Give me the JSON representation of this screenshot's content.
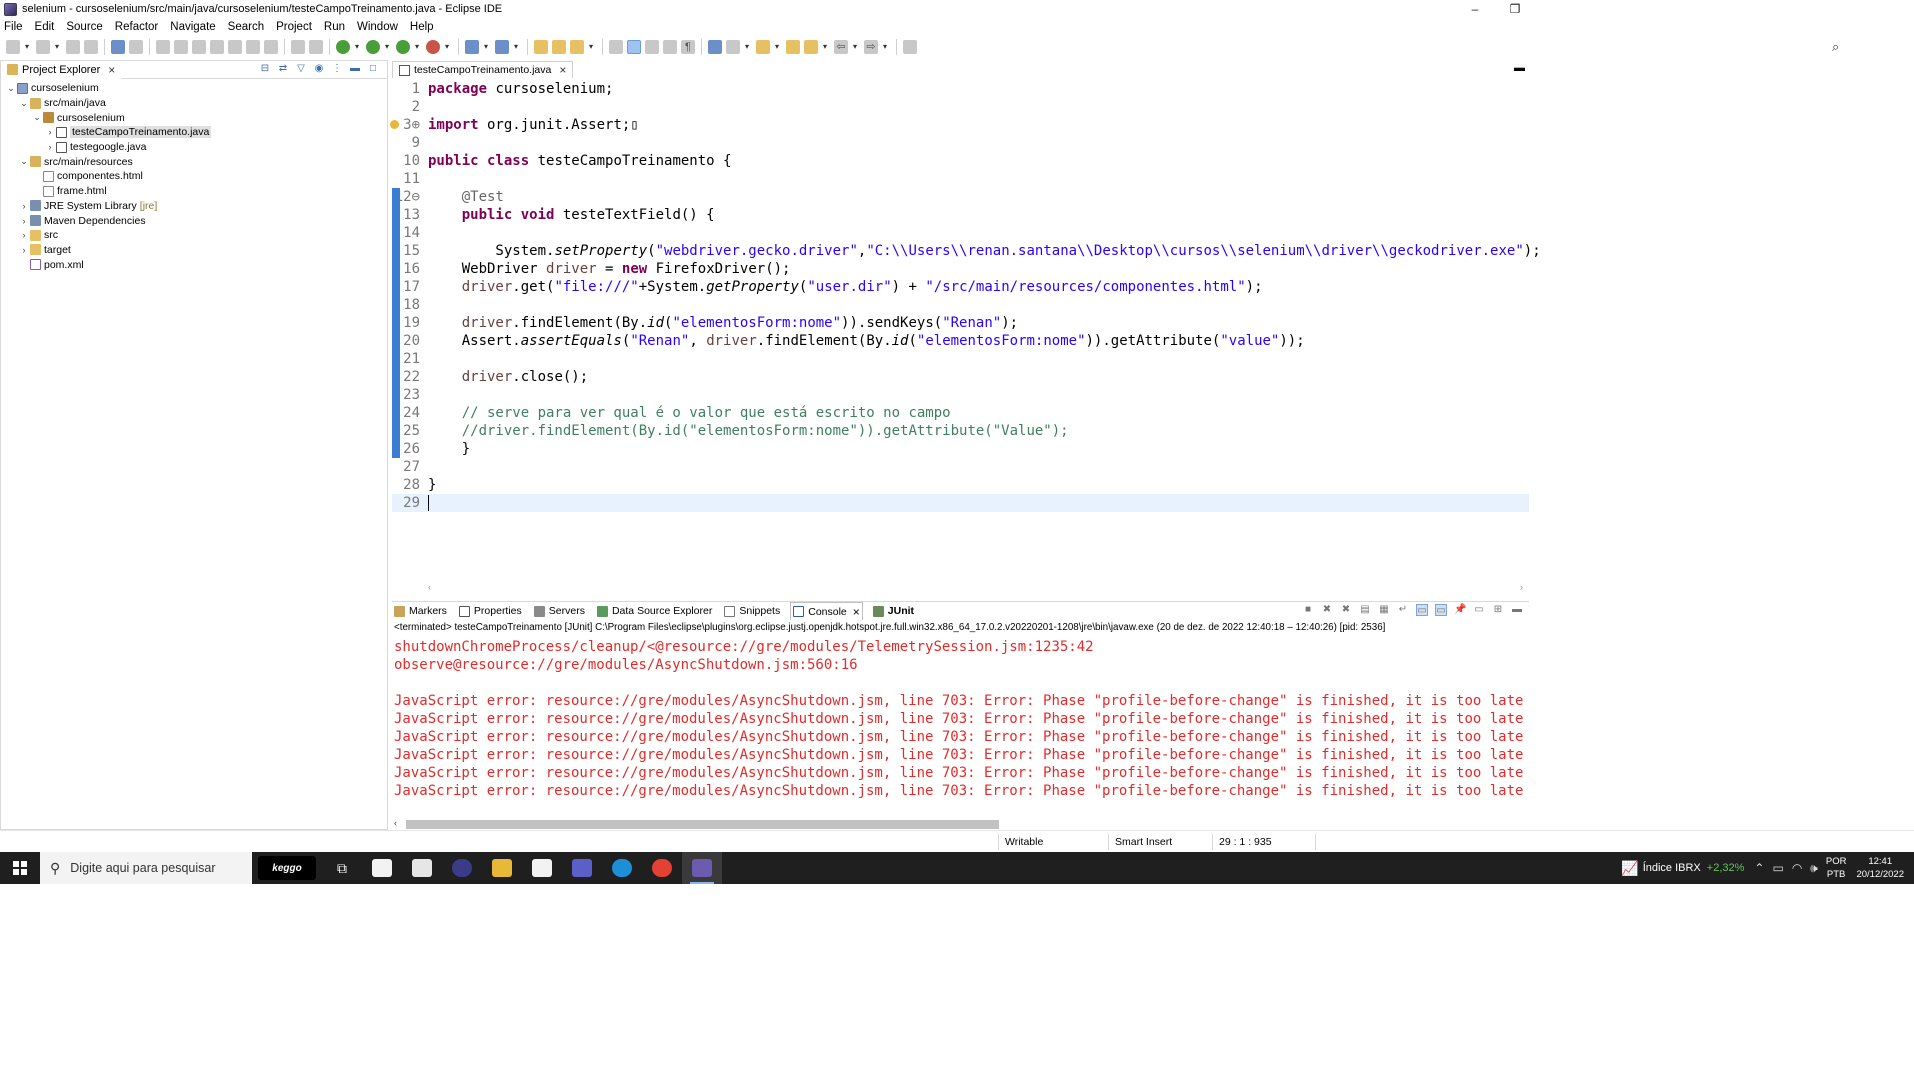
{
  "window": {
    "title": "selenium - cursoselenium/src/main/java/cursoselenium/testeCampoTreinamento.java - Eclipse IDE",
    "minimize": "–",
    "restore": "❐"
  },
  "menu": [
    "File",
    "Edit",
    "Source",
    "Refactor",
    "Navigate",
    "Search",
    "Project",
    "Run",
    "Window",
    "Help"
  ],
  "project_explorer": {
    "tab_label": "Project Explorer",
    "tree": [
      {
        "label": "cursoselenium",
        "twisty": "⌄",
        "icon": "proj",
        "indent": 0
      },
      {
        "label": "src/main/java",
        "twisty": "⌄",
        "icon": "srcf",
        "indent": 1
      },
      {
        "label": "cursoselenium",
        "twisty": "⌄",
        "icon": "pkg",
        "indent": 2
      },
      {
        "label": "testeCampoTreinamento.java",
        "twisty": "›",
        "icon": "java",
        "indent": 3,
        "selected": true
      },
      {
        "label": "testegoogle.java",
        "twisty": "›",
        "icon": "java",
        "indent": 3
      },
      {
        "label": "src/main/resources",
        "twisty": "⌄",
        "icon": "srcf",
        "indent": 1
      },
      {
        "label": "componentes.html",
        "twisty": "",
        "icon": "html",
        "indent": 2
      },
      {
        "label": "frame.html",
        "twisty": "",
        "icon": "html",
        "indent": 2
      },
      {
        "label": "JRE System Library",
        "decoration": "[jre]",
        "twisty": "›",
        "icon": "lib",
        "indent": 1
      },
      {
        "label": "Maven Dependencies",
        "twisty": "›",
        "icon": "lib",
        "indent": 1
      },
      {
        "label": "src",
        "twisty": "›",
        "icon": "fold",
        "indent": 1
      },
      {
        "label": "target",
        "twisty": "›",
        "icon": "fold",
        "indent": 1
      },
      {
        "label": "pom.xml",
        "twisty": "",
        "icon": "xml",
        "indent": 1
      }
    ]
  },
  "editor": {
    "tab_label": "testeCampoTreinamento.java",
    "lines": [
      {
        "n": "1",
        "html": "<span class=\"kw\">package</span> cursoselenium;"
      },
      {
        "n": "2",
        "html": ""
      },
      {
        "n": "3⊕",
        "html": "<span class=\"kw\">import</span> org.junit.Assert;▯"
      },
      {
        "n": "9",
        "html": ""
      },
      {
        "n": "10",
        "html": "<span class=\"kw\">public class</span> testeCampoTreinamento {"
      },
      {
        "n": "11",
        "html": ""
      },
      {
        "n": "12⊖",
        "html": "    <span class=\"ann\">@Test</span>"
      },
      {
        "n": "13",
        "html": "    <span class=\"kw\">public void</span> testeTextField() {"
      },
      {
        "n": "14",
        "html": ""
      },
      {
        "n": "15",
        "html": "        System.<span class=\"it\">setProperty</span>(<span class=\"str\">\"webdriver.gecko.driver\"</span>,<span class=\"str\">\"C:\\\\Users\\\\renan.santana\\\\Desktop\\\\cursos\\\\selenium\\\\driver\\\\geckodriver.exe\"</span>);"
      },
      {
        "n": "16",
        "html": "    WebDriver <span class=\"var\">driver</span> = <span class=\"kw\">new</span> FirefoxDriver();"
      },
      {
        "n": "17",
        "html": "    <span class=\"var\">driver</span>.get(<span class=\"str\">\"file:///\"</span>+System.<span class=\"it\">getProperty</span>(<span class=\"str\">\"user.dir\"</span>) + <span class=\"str\">\"/src/main/resources/componentes.html\"</span>);"
      },
      {
        "n": "18",
        "html": ""
      },
      {
        "n": "19",
        "html": "    <span class=\"var\">driver</span>.findElement(By.<span class=\"it\">id</span>(<span class=\"str\">\"elementosForm:nome\"</span>)).sendKeys(<span class=\"str\">\"Renan\"</span>);"
      },
      {
        "n": "20",
        "html": "    Assert.<span class=\"it\">assertEquals</span>(<span class=\"str\">\"Renan\"</span>, <span class=\"var\">driver</span>.findElement(By.<span class=\"it\">id</span>(<span class=\"str\">\"elementosForm:nome\"</span>)).getAttribute(<span class=\"str\">\"value\"</span>));"
      },
      {
        "n": "21",
        "html": ""
      },
      {
        "n": "22",
        "html": "    <span class=\"var\">driver</span>.close();"
      },
      {
        "n": "23",
        "html": ""
      },
      {
        "n": "24",
        "html": "    <span class=\"cmt\">// serve para ver qual é o valor que está escrito no campo</span>"
      },
      {
        "n": "25",
        "html": "    <span class=\"cmt\">//driver.findElement(By.id(\"elementosForm:nome\")).getAttribute(\"Value\");</span>"
      },
      {
        "n": "26",
        "html": "    }"
      },
      {
        "n": "27",
        "html": ""
      },
      {
        "n": "28",
        "html": "}"
      },
      {
        "n": "29",
        "html": ""
      }
    ]
  },
  "bottom_panel": {
    "tabs": [
      "Markers",
      "Properties",
      "Servers",
      "Data Source Explorer",
      "Snippets",
      "Console",
      "JUnit"
    ],
    "active_tab": "Console",
    "terminated_line": "<terminated> testeCampoTreinamento [JUnit] C:\\Program Files\\eclipse\\plugins\\org.eclipse.justj.openjdk.hotspot.jre.full.win32.x86_64_17.0.2.v20220201-1208\\jre\\bin\\javaw.exe  (20 de dez. de 2022 12:40:18 – 12:40:26) [pid: 2536]",
    "console_lines": [
      "shutdownChromeProcess/cleanup/<@resource://gre/modules/TelemetrySession.jsm:1235:42",
      "observe@resource://gre/modules/AsyncShutdown.jsm:560:16",
      "",
      "JavaScript error: resource://gre/modules/AsyncShutdown.jsm, line 703: Error: Phase \"profile-before-change\" is finished, it is too late to r",
      "JavaScript error: resource://gre/modules/AsyncShutdown.jsm, line 703: Error: Phase \"profile-before-change\" is finished, it is too late to r",
      "JavaScript error: resource://gre/modules/AsyncShutdown.jsm, line 703: Error: Phase \"profile-before-change\" is finished, it is too late to r",
      "JavaScript error: resource://gre/modules/AsyncShutdown.jsm, line 703: Error: Phase \"profile-before-change\" is finished, it is too late to r",
      "JavaScript error: resource://gre/modules/AsyncShutdown.jsm, line 703: Error: Phase \"profile-before-change\" is finished, it is too late to r",
      "JavaScript error: resource://gre/modules/AsyncShutdown.jsm, line 703: Error: Phase \"profile-before-change\" is finished, it is too late to r"
    ]
  },
  "status_bar": {
    "writable": "Writable",
    "insert_mode": "Smart Insert",
    "position": "29 : 1 : 935"
  },
  "taskbar": {
    "search_placeholder": "Digite aqui para pesquisar",
    "keggo_label": "keggo",
    "ibrx_label": "Índice IBRX",
    "ibrx_change": "+2,32%",
    "lang_top": "POR",
    "lang_bottom": "PTB",
    "time": "12:41",
    "date": "20/12/2022"
  },
  "colors": {
    "keyword": "#7f0055",
    "string": "#2a00ff",
    "comment": "#3f7f5f",
    "console_error": "#e22b2b",
    "current_line": "#e8f2fe"
  }
}
